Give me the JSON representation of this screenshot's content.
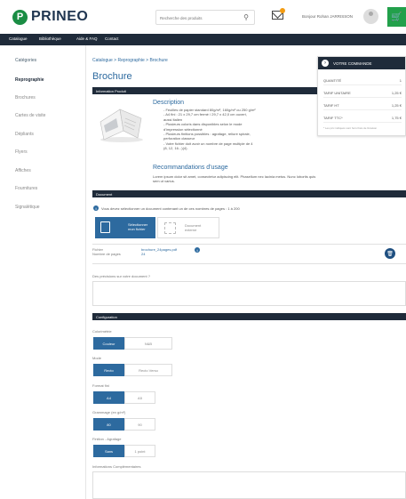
{
  "header": {
    "logo_mark": "P",
    "logo_text": "PRINEO",
    "search_placeholder": "Recherche des produits",
    "user_name": "Bonjour Rohan JARRISSON",
    "cart_icon": "shopping-cart-icon"
  },
  "nav": {
    "items": [
      {
        "label": "Catalogue"
      },
      {
        "label": "Bibliothèque"
      },
      {
        "label": "Aide & FAQ"
      },
      {
        "label": "Contact"
      }
    ]
  },
  "sidebar": {
    "title": "Catégories",
    "items": [
      {
        "label": "Reprographie",
        "active": true
      },
      {
        "label": "Brochures",
        "active": false
      },
      {
        "label": "Cartes de visite",
        "active": false
      },
      {
        "label": "Dépliants",
        "active": false
      },
      {
        "label": "Flyers",
        "active": false
      },
      {
        "label": "Affiches",
        "active": false
      },
      {
        "label": "Fournitures",
        "active": false
      },
      {
        "label": "Signalétique",
        "active": false
      }
    ]
  },
  "breadcrumb": "Catalogue > Reprographie > Brochure",
  "page_title": "Brochure",
  "product": {
    "section_label": "Information Produit",
    "description_heading": "Description",
    "description_lines": [
      "- Feuilles de papier standard 80g/m², 160g/m² ou 250 g/m²",
      "- A4 fini : 21 x 29,7 cm fermé / 29,7 x 42,0 cm ouvert,",
      "aussi Italien",
      "- Plusieurs coloris dans disponibles selon le mode",
      "d'impression sélectionné",
      "- Plusieurs finitions possibles : agrafage, reliure spirale,",
      "perforation classeur",
      "- Votre fichier doit avoir un nombre de page multiple de 4",
      "(8, 12, 16...)(4)."
    ],
    "usage_heading": "Recommandations d'usage",
    "usage_text": "Lorem ipsum dolor sit amet, consectetur adipiscing elit. Phasellum nec lacinia metus. Nunc lobortis quis sem ut varius."
  },
  "order": {
    "title": "VOTRE COMMANDE",
    "toggle_icon": "chevron-right-icon",
    "rows": [
      {
        "label": "QUANTITÉ",
        "value": "1"
      },
      {
        "label": "TARIF UNITAIRE",
        "value": "1,25 €"
      },
      {
        "label": "TARIF HT",
        "value": "1,25 €"
      },
      {
        "label": "TARIF TTC*",
        "value": "1,75 €"
      }
    ],
    "note": "* Les prix indiqués sont hors frais de livraison"
  },
  "document": {
    "section_label": "Document",
    "hint": "Vous devez sélectionner un document contenant un de ces nombres de pages : 1 à 200",
    "upload_label_line1": "Sélectionner",
    "upload_label_line2": "mon fichier",
    "external_label_line1": "Document",
    "external_label_line2": "externe",
    "file_label": "Fichier",
    "pages_label": "Nombre de pages",
    "file_name": "brochure_24pages.pdf",
    "page_count": "24",
    "details_label": "Des précisions sur votre document ?",
    "details_value": ""
  },
  "configuration": {
    "section_label": "Configuration",
    "groups": [
      {
        "label": "Colorimétrie",
        "options": [
          "Couleur",
          "N&B"
        ],
        "selected": 0
      },
      {
        "label": "Mode",
        "options": [
          "Recto",
          "Recto Verso"
        ],
        "selected": 0
      },
      {
        "label": "Format fini",
        "options": [
          "A4",
          "A5"
        ],
        "selected": 0
      },
      {
        "label": "Grammage (en g/m²)",
        "options": [
          "80",
          "90"
        ],
        "selected": 0
      },
      {
        "label": "Finition - Agrafage",
        "options": [
          "Sans",
          "1 point"
        ],
        "selected": 0
      }
    ],
    "extra_label": "Informations Complémentaires",
    "extra_value": ""
  },
  "colors": {
    "primary_blue": "#2d6a9f",
    "dark_navy": "#1f2b3a",
    "brand_green": "#1a8d44"
  }
}
